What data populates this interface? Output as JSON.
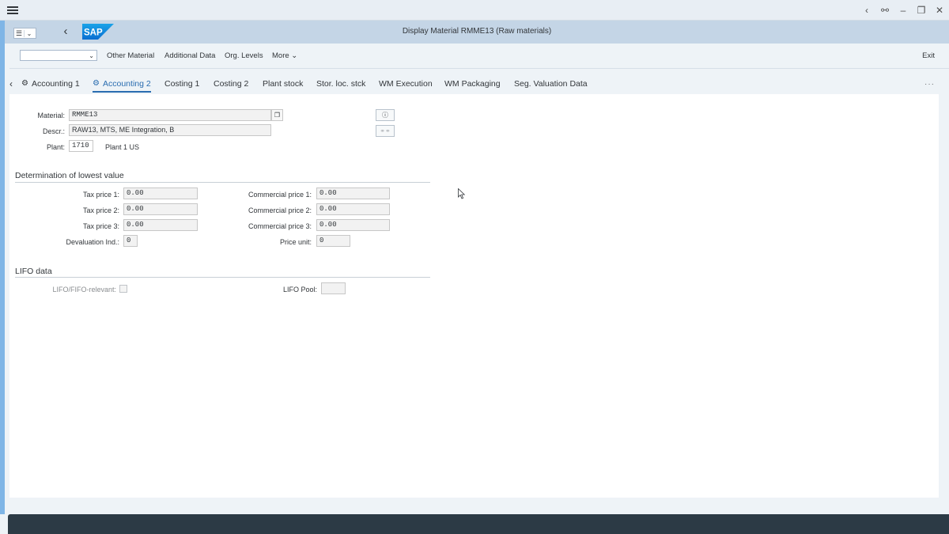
{
  "window": {
    "title": "Display Material RMME13 (Raw materials)"
  },
  "toolbar": {
    "dropdown_value": "",
    "items": [
      "Other Material",
      "Additional Data",
      "Org. Levels",
      "More"
    ],
    "exit_label": "Exit"
  },
  "tabs": [
    "Accounting 1",
    "Accounting 2",
    "Costing 1",
    "Costing 2",
    "Plant stock",
    "Stor. loc. stck",
    "WM Execution",
    "WM Packaging",
    "Seg. Valuation Data"
  ],
  "active_tab": "Accounting 2",
  "header_fields": {
    "material_label": "Material:",
    "material_value": "RMME13",
    "descr_label": "Descr.:",
    "descr_value": "RAW13, MTS, ME Integration, B",
    "plant_label": "Plant:",
    "plant_value": "1710",
    "plant_text": "Plant 1 US"
  },
  "lowest_value": {
    "title": "Determination of lowest value",
    "tax_price_1_label": "Tax price 1:",
    "tax_price_1": "0.00",
    "tax_price_2_label": "Tax price 2:",
    "tax_price_2": "0.00",
    "tax_price_3_label": "Tax price 3:",
    "tax_price_3": "0.00",
    "devaluation_label": "Devaluation Ind.:",
    "devaluation": "0",
    "commercial_price_1_label": "Commercial price 1:",
    "commercial_price_1": "0.00",
    "commercial_price_2_label": "Commercial price 2:",
    "commercial_price_2": "0.00",
    "commercial_price_3_label": "Commercial price 3:",
    "commercial_price_3": "0.00",
    "price_unit_label": "Price unit:",
    "price_unit": "0"
  },
  "lifo": {
    "title": "LIFO data",
    "relevant_label": "LIFO/FIFO-relevant:",
    "pool_label": "LIFO Pool:",
    "pool_value": ""
  },
  "icons": {
    "menu": "hamburger-icon",
    "back": "chevron-left-icon",
    "info": "info-icon",
    "glasses": "glasses-icon"
  }
}
